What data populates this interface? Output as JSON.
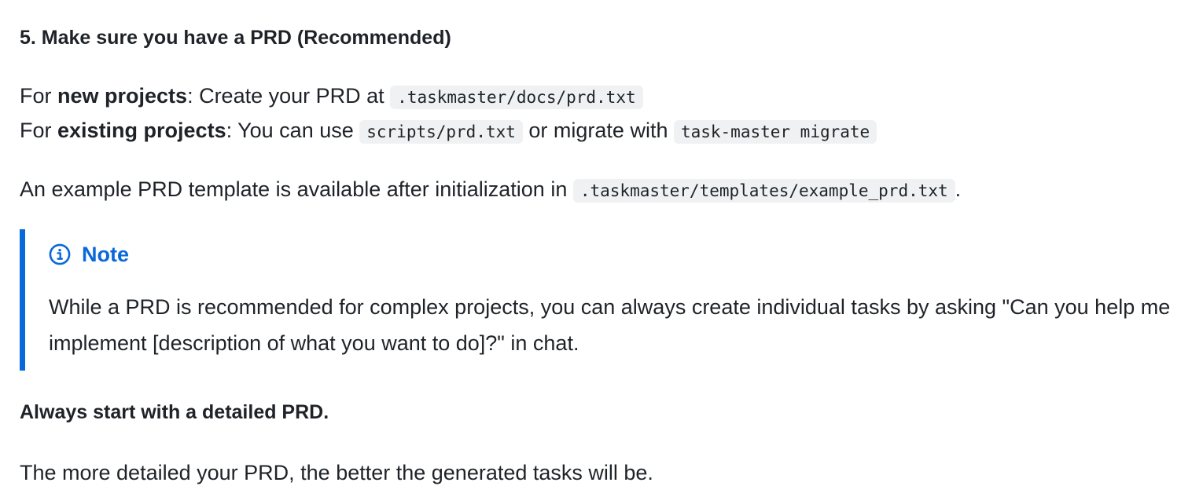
{
  "heading": "5. Make sure you have a PRD (Recommended)",
  "line1": {
    "prefix": "For ",
    "bold": "new projects",
    "text": ": Create your PRD at ",
    "code": ".taskmaster/docs/prd.txt"
  },
  "line2": {
    "prefix": "For ",
    "bold": "existing projects",
    "text": ": You can use ",
    "code1": "scripts/prd.txt",
    "middle": " or migrate with ",
    "code2": "task-master migrate"
  },
  "line3": {
    "text": "An example PRD template is available after initialization in ",
    "code": ".taskmaster/templates/example_prd.txt",
    "suffix": "."
  },
  "note": {
    "icon": "info-icon",
    "accent_color": "#0969da",
    "title": "Note",
    "body": "While a PRD is recommended for complex projects, you can always create individual tasks by asking \"Can you help me implement [description of what you want to do]?\" in chat."
  },
  "emphasis": "Always start with a detailed PRD.",
  "closing": "The more detailed your PRD, the better the generated tasks will be."
}
